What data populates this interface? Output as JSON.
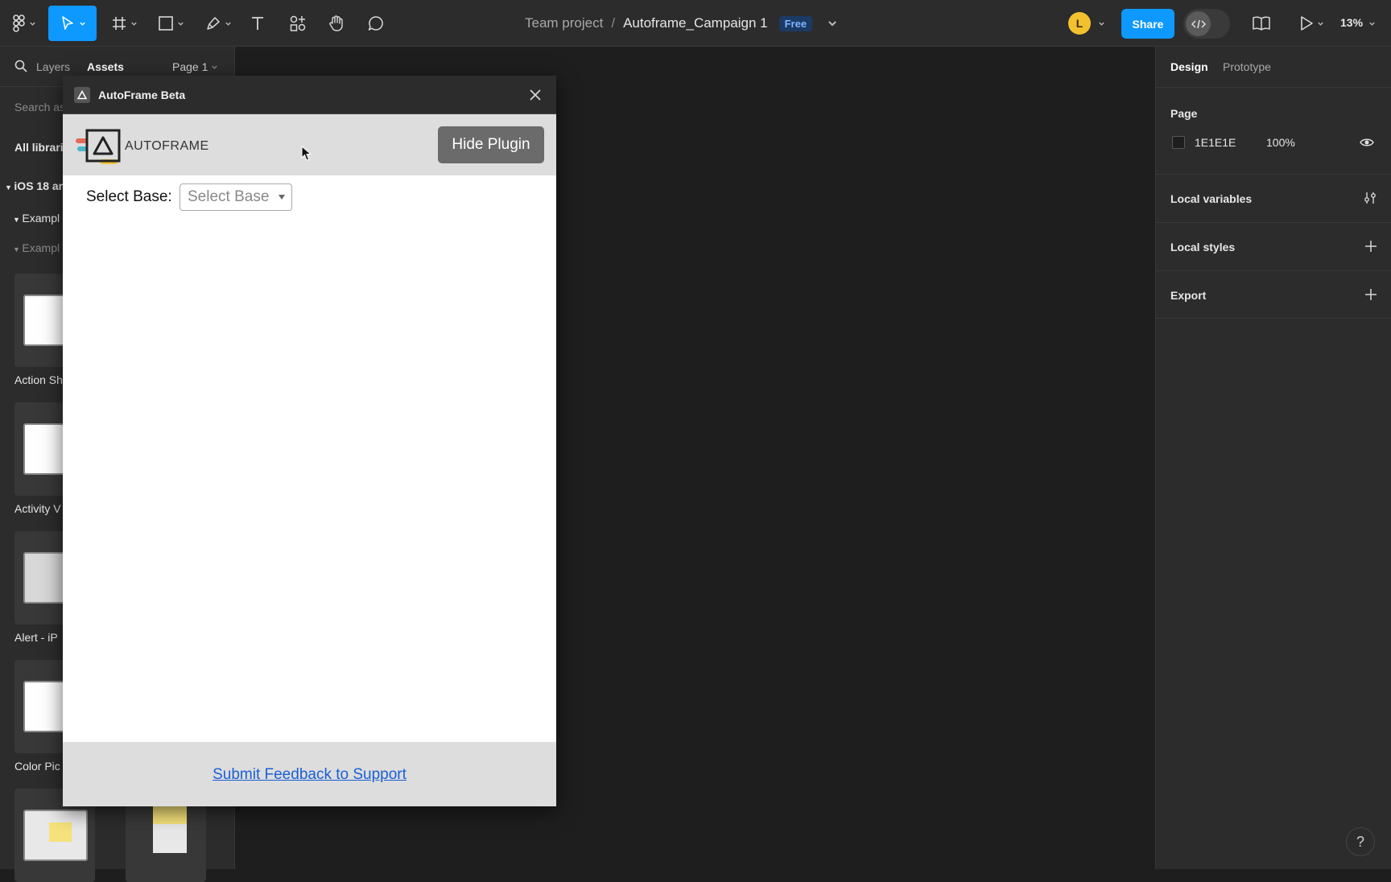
{
  "toolbar": {
    "team_project": "Team project",
    "separator": "/",
    "file_name": "Autoframe_Campaign 1",
    "plan_badge": "Free",
    "avatar_initial": "L",
    "share_label": "Share",
    "zoom": "13%"
  },
  "left_panel": {
    "tabs": {
      "layers": "Layers",
      "assets": "Assets"
    },
    "page": "Page 1",
    "search_placeholder": "Search as",
    "all_libraries": "All librarie",
    "library": "iOS 18 an",
    "group1": "Exampl",
    "group2": "Exampl",
    "items": [
      "Action Sh",
      "Activity V",
      "Alert - iP",
      "Color Pic"
    ]
  },
  "right_panel": {
    "tabs": {
      "design": "Design",
      "prototype": "Prototype"
    },
    "page_section": "Page",
    "page_color": "1E1E1E",
    "page_opacity": "100%",
    "local_variables": "Local variables",
    "local_styles": "Local styles",
    "export": "Export"
  },
  "plugin": {
    "title": "AutoFrame Beta",
    "logo_text": "AUTOFRAME",
    "hide_button": "Hide Plugin",
    "select_label": "Select Base:",
    "select_value": "Select Base",
    "feedback_link": "Submit Feedback to Support"
  },
  "help": "?",
  "colors": {
    "accent": "#0d99ff",
    "canvas": "#1e1e1e",
    "panel": "#2c2c2c",
    "avatar": "#f2c12e"
  }
}
